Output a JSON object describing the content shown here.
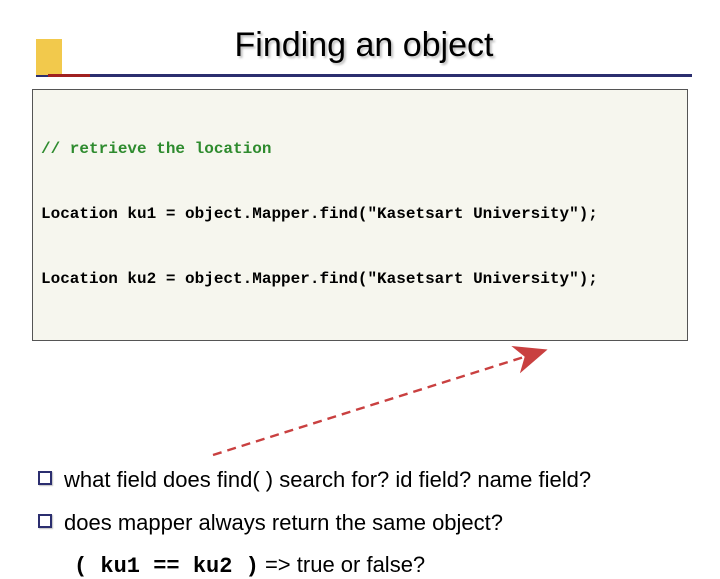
{
  "title": "Finding an object",
  "code": {
    "l1": "// retrieve the location",
    "l2": "Location ku1 = object.Mapper.find(\"Kasetsart University\");",
    "l3": "Location ku2 = object.Mapper.find(\"Kasetsart University\");"
  },
  "bullets": {
    "q1": "what field does find( ) search for?  id field?  name field?",
    "q2": "does mapper always return the same object?"
  },
  "sub": {
    "expr": "( ku1 == ku2 )",
    "result": "  => true or false?"
  },
  "arrow_color": "#c94040"
}
